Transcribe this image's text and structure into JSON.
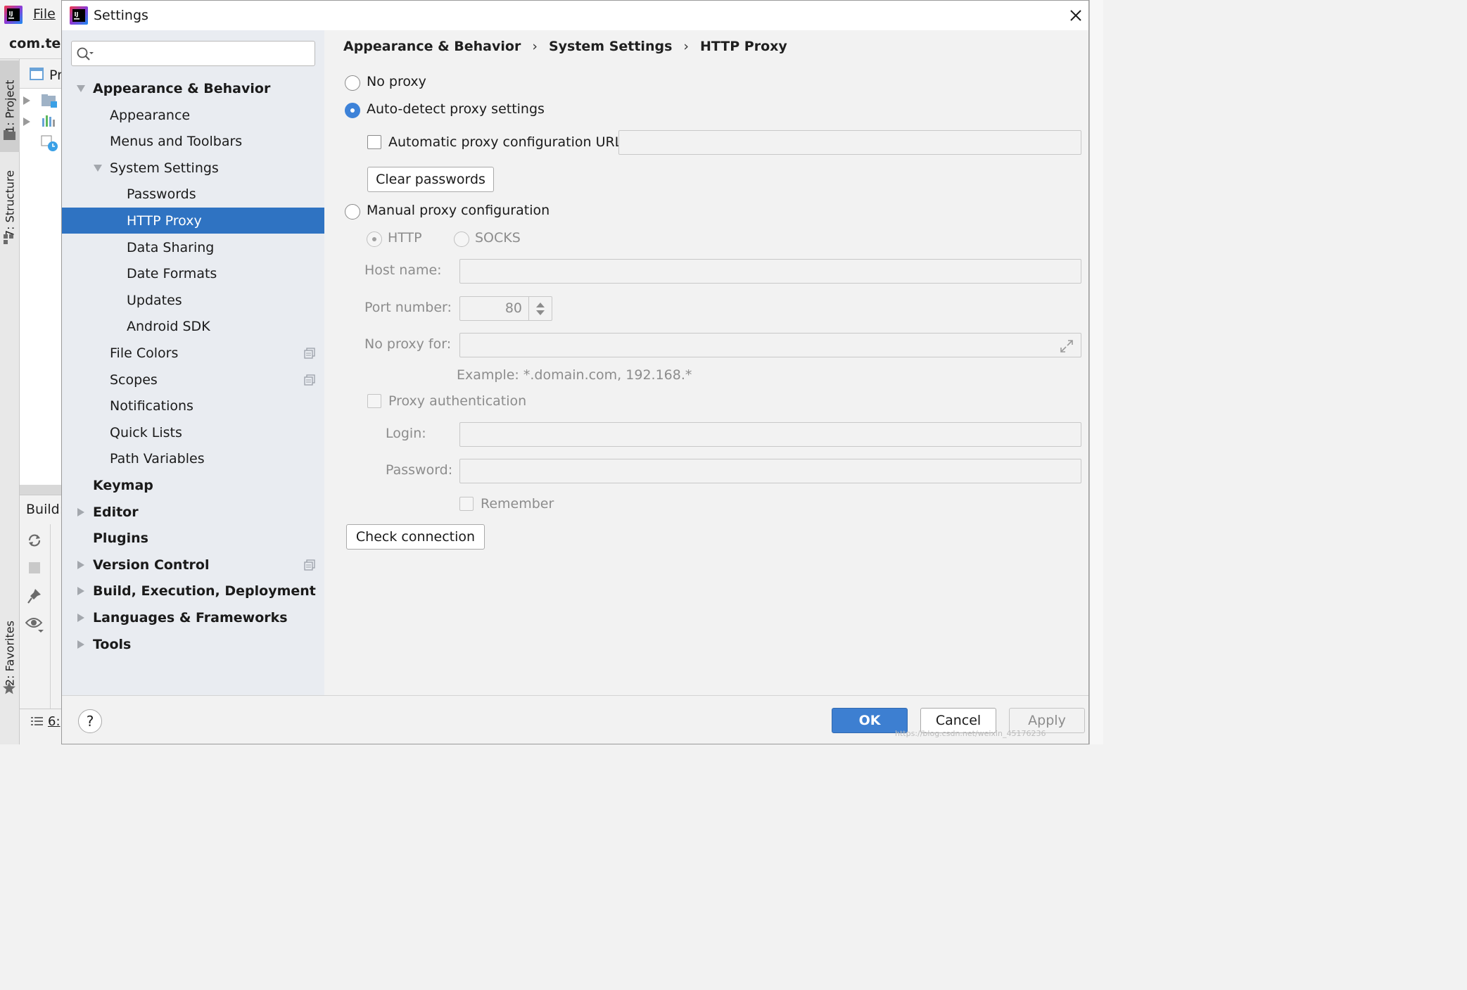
{
  "ide": {
    "menu_file": "File",
    "project_name": "com.test",
    "tree_header": "Pr",
    "tab_project": "1: Project",
    "tab_structure": "7: Structure",
    "tab_favorites": "2: Favorites",
    "build_label": "Build:",
    "bottom_label": "6:"
  },
  "dialog": {
    "title": "Settings",
    "search": {
      "placeholder": "",
      "value": ""
    },
    "breadcrumb": [
      "Appearance & Behavior",
      "System Settings",
      "HTTP Proxy"
    ],
    "tree": [
      {
        "label": "Appearance & Behavior",
        "level": 0,
        "bold": true,
        "arrow": "expanded"
      },
      {
        "label": "Appearance",
        "level": 1
      },
      {
        "label": "Menus and Toolbars",
        "level": 1
      },
      {
        "label": "System Settings",
        "level": 1,
        "arrow": "expanded"
      },
      {
        "label": "Passwords",
        "level": 2
      },
      {
        "label": "HTTP Proxy",
        "level": 2,
        "selected": true
      },
      {
        "label": "Data Sharing",
        "level": 2
      },
      {
        "label": "Date Formats",
        "level": 2
      },
      {
        "label": "Updates",
        "level": 2
      },
      {
        "label": "Android SDK",
        "level": 2
      },
      {
        "label": "File Colors",
        "level": 1,
        "copy_icon": true
      },
      {
        "label": "Scopes",
        "level": 1,
        "copy_icon": true
      },
      {
        "label": "Notifications",
        "level": 1
      },
      {
        "label": "Quick Lists",
        "level": 1
      },
      {
        "label": "Path Variables",
        "level": 1
      },
      {
        "label": "Keymap",
        "level": 0,
        "bold": true
      },
      {
        "label": "Editor",
        "level": 0,
        "bold": true,
        "arrow": "collapsed"
      },
      {
        "label": "Plugins",
        "level": 0,
        "bold": true
      },
      {
        "label": "Version Control",
        "level": 0,
        "bold": true,
        "arrow": "collapsed",
        "copy_icon": true
      },
      {
        "label": "Build, Execution, Deployment",
        "level": 0,
        "bold": true,
        "arrow": "collapsed"
      },
      {
        "label": "Languages & Frameworks",
        "level": 0,
        "bold": true,
        "arrow": "collapsed"
      },
      {
        "label": "Tools",
        "level": 0,
        "bold": true,
        "arrow": "collapsed"
      }
    ],
    "proxy": {
      "no_proxy_label": "No proxy",
      "auto_detect_label": "Auto-detect proxy settings",
      "auto_config_url_label": "Automatic proxy configuration URL:",
      "auto_config_url_value": "",
      "clear_passwords_label": "Clear passwords",
      "manual_label": "Manual proxy configuration",
      "http_label": "HTTP",
      "socks_label": "SOCKS",
      "host_label": "Host name:",
      "host_value": "",
      "port_label": "Port number:",
      "port_value": "80",
      "no_proxy_for_label": "No proxy for:",
      "no_proxy_for_value": "",
      "example_text": "Example: *.domain.com, 192.168.*",
      "proxy_auth_label": "Proxy authentication",
      "login_label": "Login:",
      "login_value": "",
      "password_label": "Password:",
      "password_value": "",
      "remember_label": "Remember",
      "check_connection_label": "Check connection",
      "selected_mode": "auto-detect"
    },
    "footer": {
      "help_label": "?",
      "ok_label": "OK",
      "cancel_label": "Cancel",
      "apply_label": "Apply"
    },
    "watermark": "https://blog.csdn.net/weixin_45176236"
  },
  "colors": {
    "accent": "#2f73c2",
    "sidebar_bg": "#e9ecf1",
    "selected_text": "#ffffff"
  }
}
